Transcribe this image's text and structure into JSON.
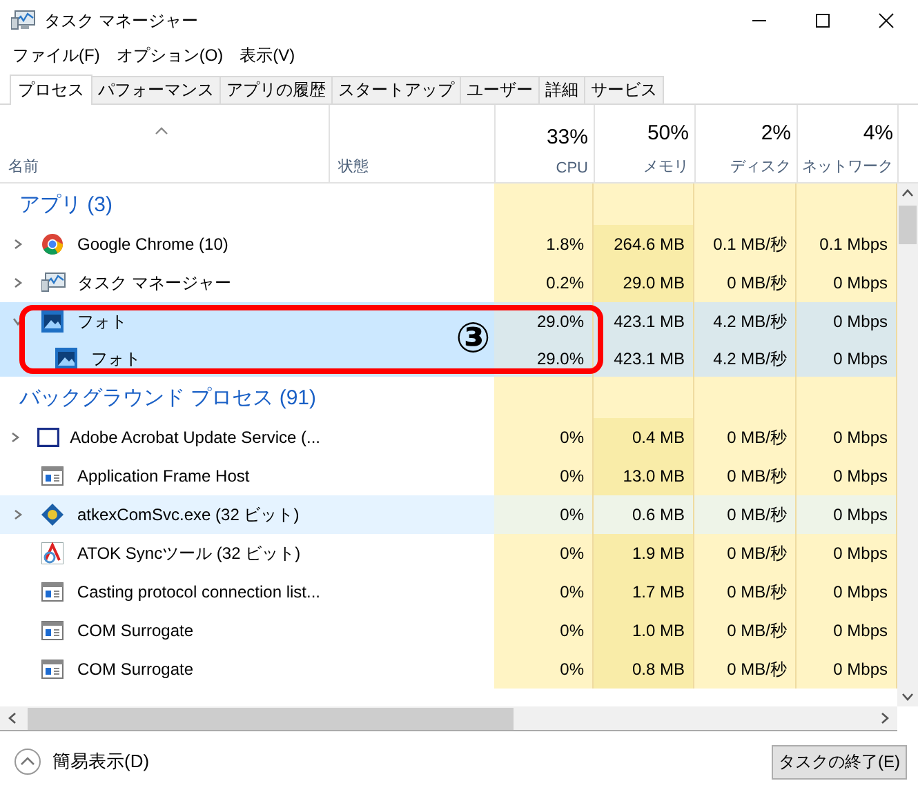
{
  "window": {
    "title": "タスク マネージャー"
  },
  "menu": [
    "ファイル(F)",
    "オプション(O)",
    "表示(V)"
  ],
  "tabs": [
    {
      "label": "プロセス",
      "selected": true
    },
    {
      "label": "パフォーマンス",
      "selected": false
    },
    {
      "label": "アプリの履歴",
      "selected": false
    },
    {
      "label": "スタートアップ",
      "selected": false
    },
    {
      "label": "ユーザー",
      "selected": false
    },
    {
      "label": "詳細",
      "selected": false
    },
    {
      "label": "サービス",
      "selected": false
    }
  ],
  "columns": [
    {
      "label": "名前"
    },
    {
      "label": "状態"
    },
    {
      "percent": "33%",
      "label": "CPU"
    },
    {
      "percent": "50%",
      "label": "メモリ"
    },
    {
      "percent": "2%",
      "label": "ディスク"
    },
    {
      "percent": "4%",
      "label": "ネットワーク"
    }
  ],
  "sections": [
    {
      "title": "アプリ (3)",
      "rows": [
        {
          "name": "Google Chrome (10)",
          "cpu": "1.8%",
          "memory": "264.6 MB",
          "disk": "0.1 MB/秒",
          "network": "0.1 Mbps",
          "expanded": false,
          "selected": false,
          "highlighted": false
        },
        {
          "name": "タスク マネージャー",
          "cpu": "0.2%",
          "memory": "29.0 MB",
          "disk": "0 MB/秒",
          "network": "0 Mbps",
          "expanded": false,
          "selected": false,
          "highlighted": false
        },
        {
          "name": "フォト",
          "cpu": "29.0%",
          "memory": "423.1 MB",
          "disk": "4.2 MB/秒",
          "network": "0 Mbps",
          "expanded": true,
          "selected": true,
          "highlighted": false,
          "annotation": "③",
          "children": [
            {
              "name": "フォト",
              "cpu": "29.0%",
              "memory": "423.1 MB",
              "disk": "4.2 MB/秒",
              "network": "0 Mbps",
              "selected": true,
              "highlighted": false
            }
          ]
        }
      ]
    },
    {
      "title": "バックグラウンド プロセス (91)",
      "rows": [
        {
          "name": "Adobe Acrobat Update Service (...",
          "cpu": "0%",
          "memory": "0.4 MB",
          "disk": "0 MB/秒",
          "network": "0 Mbps",
          "expanded": false,
          "selected": false,
          "highlighted": false
        },
        {
          "name": "Application Frame Host",
          "cpu": "0%",
          "memory": "13.0 MB",
          "disk": "0 MB/秒",
          "network": "0 Mbps",
          "selected": false,
          "highlighted": false
        },
        {
          "name": "atkexComSvc.exe (32 ビット)",
          "cpu": "0%",
          "memory": "0.6 MB",
          "disk": "0 MB/秒",
          "network": "0 Mbps",
          "expanded": false,
          "selected": false,
          "highlighted": true
        },
        {
          "name": "ATOK Syncツール (32 ビット)",
          "cpu": "0%",
          "memory": "1.9 MB",
          "disk": "0 MB/秒",
          "network": "0 Mbps",
          "selected": false,
          "highlighted": false
        },
        {
          "name": "Casting protocol connection list...",
          "cpu": "0%",
          "memory": "1.7 MB",
          "disk": "0 MB/秒",
          "network": "0 Mbps",
          "selected": false,
          "highlighted": false
        },
        {
          "name": "COM Surrogate",
          "cpu": "0%",
          "memory": "1.0 MB",
          "disk": "0 MB/秒",
          "network": "0 Mbps",
          "selected": false,
          "highlighted": false
        },
        {
          "name": "COM Surrogate",
          "cpu": "0%",
          "memory": "0.8 MB",
          "disk": "0 MB/秒",
          "network": "0 Mbps",
          "selected": false,
          "highlighted": false
        }
      ]
    }
  ],
  "footer": {
    "fewer_details": "簡易表示(D)",
    "end_task": "タスクの終了(E)"
  }
}
